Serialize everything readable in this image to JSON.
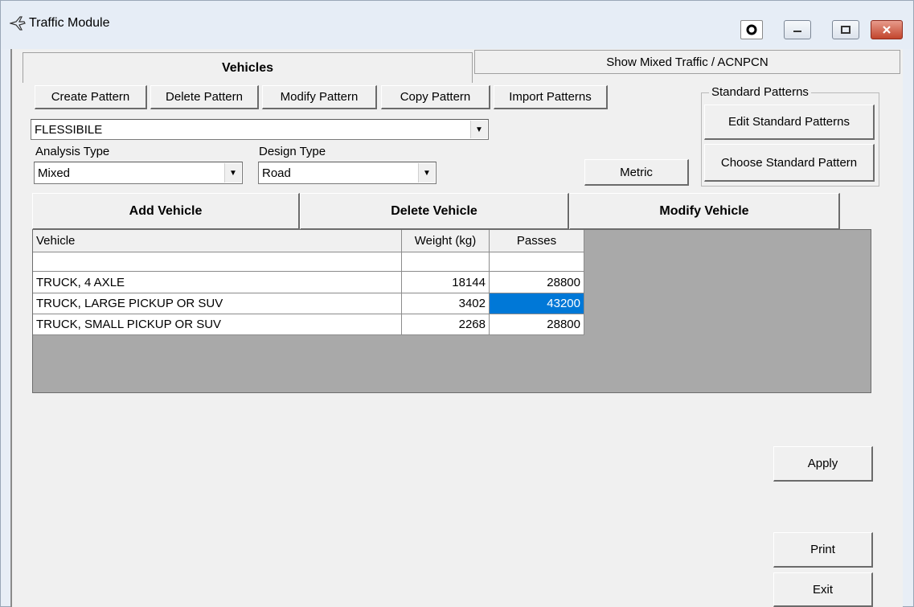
{
  "window": {
    "title": "Traffic Module",
    "colors": {
      "title_bg": "#e6edf6",
      "close": "#c2452d",
      "selection": "#0078d7",
      "grid_bg": "#a9a9a9"
    }
  },
  "tabs": [
    {
      "label": "Vehicles",
      "active": true
    },
    {
      "label": "Show Mixed Traffic / ACNPCN",
      "active": false
    }
  ],
  "pattern_buttons": {
    "create": "Create Pattern",
    "delete": "Delete Pattern",
    "modify": "Modify Pattern",
    "copy": "Copy Pattern",
    "import": "Import Patterns"
  },
  "pattern_select": {
    "value": "FLESSIBILE"
  },
  "standard_patterns": {
    "label": "Standard Patterns",
    "edit": "Edit Standard Patterns",
    "choose": "Choose Standard Pattern"
  },
  "analysis_type": {
    "label": "Analysis Type",
    "value": "Mixed"
  },
  "design_type": {
    "label": "Design  Type",
    "value": "Road"
  },
  "metric_button": "Metric",
  "vehicle_buttons": {
    "add": "Add Vehicle",
    "delete": "Delete Vehicle",
    "modify": "Modify Vehicle"
  },
  "grid": {
    "headers": [
      "Vehicle",
      "Weight (kg)",
      "Passes"
    ],
    "rows": [
      [
        "",
        "",
        ""
      ],
      [
        "TRUCK, 4 AXLE",
        "18144",
        "28800"
      ],
      [
        "TRUCK, LARGE PICKUP OR SUV",
        "3402",
        "43200"
      ],
      [
        "TRUCK, SMALL PICKUP OR SUV",
        "2268",
        "28800"
      ]
    ],
    "selected_cell": "row 2, Passes"
  },
  "actions": {
    "apply": "Apply",
    "print": "Print",
    "exit": "Exit"
  }
}
